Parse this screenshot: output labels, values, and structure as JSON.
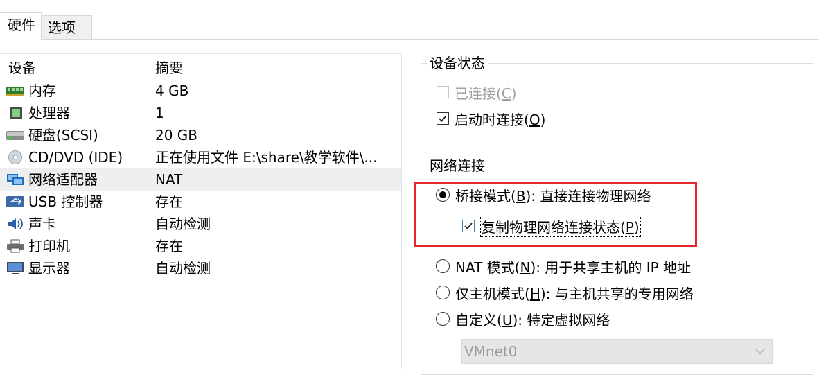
{
  "tabs": [
    {
      "label": "硬件"
    },
    {
      "label": "选项"
    }
  ],
  "device_list": {
    "columns": [
      "设备",
      "摘要"
    ],
    "rows": [
      {
        "icon": "memory-icon",
        "name": "内存",
        "summary": "4 GB"
      },
      {
        "icon": "processor-icon",
        "name": "处理器",
        "summary": "1"
      },
      {
        "icon": "harddisk-icon",
        "name": "硬盘(SCSI)",
        "summary": "20 GB"
      },
      {
        "icon": "cd-dvd-icon",
        "name": "CD/DVD (IDE)",
        "summary": "正在使用文件 E:\\share\\教学软件\\..."
      },
      {
        "icon": "network-adapter-icon",
        "name": "网络适配器",
        "summary": "NAT",
        "selected": true
      },
      {
        "icon": "usb-icon",
        "name": "USB 控制器",
        "summary": "存在"
      },
      {
        "icon": "sound-icon",
        "name": "声卡",
        "summary": "自动检测"
      },
      {
        "icon": "printer-icon",
        "name": "打印机",
        "summary": "存在"
      },
      {
        "icon": "monitor-icon",
        "name": "显示器",
        "summary": "自动检测"
      }
    ]
  },
  "device_status": {
    "legend": "设备状态",
    "connected": {
      "label": "已连接",
      "key": "C",
      "checked": false,
      "enabled": false
    },
    "connect_on_start": {
      "label": "启动时连接",
      "key": "O",
      "checked": true,
      "enabled": true
    }
  },
  "network_connection": {
    "legend": "网络连接",
    "bridged": {
      "label": "桥接模式",
      "key": "B",
      "desc": ": 直接连接物理网络",
      "selected": true
    },
    "replicate": {
      "label": "复制物理网络连接状态",
      "key": "P",
      "checked": true
    },
    "nat": {
      "label": "NAT 模式",
      "key": "N",
      "desc": ": 用于共享主机的 IP 地址",
      "selected": false
    },
    "hostonly": {
      "label": "仅主机模式",
      "key": "H",
      "desc": ": 与主机共享的专用网络",
      "selected": false
    },
    "custom": {
      "label": "自定义",
      "key": "U",
      "desc": ": 特定虚拟网络",
      "selected": false
    },
    "vmnet_select": {
      "value": "VMnet0",
      "enabled": false
    }
  },
  "colors": {
    "highlight_border": "#e3262a",
    "checkbox_blue": "#3c7fb1",
    "selected_row": "#efefef"
  }
}
